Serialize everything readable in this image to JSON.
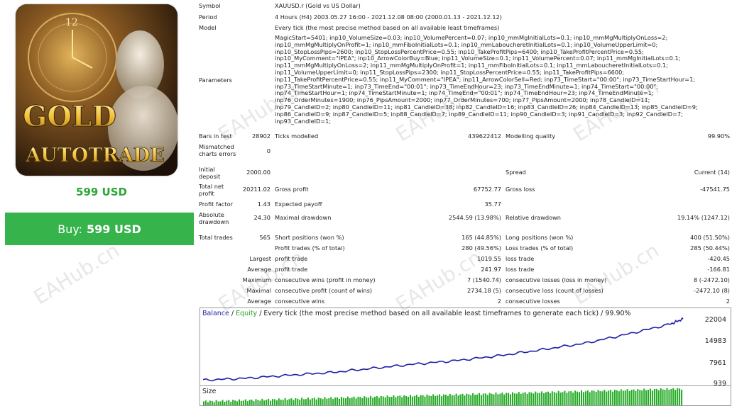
{
  "product": {
    "title_line1": "GOLD",
    "title_line2": "AUTOTRADE",
    "price": "599 USD",
    "buy_label": "Buy:",
    "buy_price": "599 USD"
  },
  "report": {
    "symbol_label": "Symbol",
    "symbol_value": "XAUUSD.r (Gold vs US Dollar)",
    "period_label": "Period",
    "period_value": "4 Hours (H4) 2003.05.27 16:00 - 2021.12.08 08:00 (2000.01.13 - 2021.12.12)",
    "model_label": "Model",
    "model_value": "Every tick (the most precise method based on all available least timeframes)",
    "parameters_label": "Parameters",
    "parameters_lines": [
      "MagicStart=5401; inp10_VolumeSize=0.03; inp10_VolumePercent=0.07; inp10_mmMgInitialLots=0.1; inp10_mmMgMultiplyOnLoss=2;",
      "inp10_mmMgMultiplyOnProfit=1; inp10_mmFiboInitialLots=0.1; inp10_mmLaboucheretInitialLots=0.1; inp10_VolumeUpperLimit=0;",
      "inp10_StopLossPips=2600; inp10_StopLossPercentPrice=0.55; inp10_TakeProfitPips=6400; inp10_TakeProfitPercentPrice=0.55;",
      "inp10_MyComment=\"IPEA\"; inp10_ArrowColorBuy=Blue; inp11_VolumeSize=0.1; inp11_VolumePercent=0.07; inp11_mmMgInitialLots=0.1;",
      "inp11_mmMgMultiplyOnLoss=2; inp11_mmMgMultiplyOnProfit=1; inp11_mmFiboInitialLots=0.1; inp11_mmLaboucheretInitialLots=0.1;",
      "inp11_VolumeUpperLimit=0; inp11_StopLossPips=2300; inp11_StopLossPercentPrice=0.55; inp11_TakeProfitPips=6600;",
      "inp11_TakeProfitPercentPrice=0.55; inp11_MyComment=\"IPEA\"; inp11_ArrowColorSell=Red; inp73_TimeStart=\"00:00\"; inp73_TimeStartHour=1;",
      "inp73_TimeStartMinute=1; inp73_TimeEnd=\"00:01\"; inp73_TimeEndHour=23; inp73_TimeEndMinute=1; inp74_TimeStart=\"00:00\";",
      "inp74_TimeStartHour=1; inp74_TimeStartMinute=1; inp74_TimeEnd=\"00:01\"; inp74_TimeEndHour=23; inp74_TimeEndMinute=1;",
      "inp76_OrderMinutes=1900; inp76_PipsAmount=2000; inp77_OrderMinutes=700; inp77_PipsAmount=2000; inp78_CandleID=11;",
      "inp79_CandleID=2; inp80_CandleID=11; inp81_CandleID=38; inp82_CandleID=16; inp83_CandleID=26; inp84_CandleID=13; inp85_CandleID=9;",
      "inp86_CandleID=9; inp87_CandleID=5; inp88_CandleID=7; inp89_CandleID=11; inp90_CandleID=3; inp91_CandleID=3; inp92_CandleID=7;",
      "inp93_CandleID=1;"
    ],
    "bars_label": "Bars in test",
    "bars_value": "28902",
    "ticks_label": "Ticks modelled",
    "ticks_value": "439622412",
    "quality_label": "Modelling quality",
    "quality_value": "99.90%",
    "mismatched_label": "Mismatched charts errors",
    "mismatched_value": "0",
    "initial_label": "Initial deposit",
    "initial_value": "2000.00",
    "spread_label": "Spread",
    "spread_value": "Current (14)",
    "netprofit_label": "Total net profit",
    "netprofit_value": "20211.02",
    "grossprofit_label": "Gross profit",
    "grossprofit_value": "67752.77",
    "grossloss_label": "Gross loss",
    "grossloss_value": "-47541.75",
    "pf_label": "Profit factor",
    "pf_value": "1.43",
    "expected_label": "Expected payoff",
    "expected_value": "35.77",
    "absdd_label": "Absolute drawdown",
    "absdd_value": "24.30",
    "maxdd_label": "Maximal drawdown",
    "maxdd_value": "2544.59 (13.98%)",
    "reldd_label": "Relative drawdown",
    "reldd_value": "19.14% (1247.12)",
    "trades_label": "Total trades",
    "trades_value": "565",
    "short_label": "Short positions (won %)",
    "short_value": "165 (44.85%)",
    "long_label": "Long positions (won %)",
    "long_value": "400 (51.50%)",
    "profittrades_label": "Profit trades (% of total)",
    "profittrades_value": "280 (49.56%)",
    "losstrades_label": "Loss trades (% of total)",
    "losstrades_value": "285 (50.44%)",
    "largest_label": "Largest",
    "largest_profit_label": "profit trade",
    "largest_profit_value": "1019.55",
    "largest_loss_label": "loss trade",
    "largest_loss_value": "-420.45",
    "average_label": "Average",
    "average_profit_label": "profit trade",
    "average_profit_value": "241.97",
    "average_loss_label": "loss trade",
    "average_loss_value": "-166.81",
    "maximum_label": "Maximum",
    "max_cw_label": "consecutive wins (profit in money)",
    "max_cw_value": "7 (1540.74)",
    "max_cl_label": "consecutive losses (loss in money)",
    "max_cl_value": "8 (-2472.10)",
    "maximal_label": "Maximal",
    "max_cp_label": "consecutive profit (count of wins)",
    "max_cp_value": "2734.18 (5)",
    "max_closs_label": "consecutive loss (count of losses)",
    "max_closs_value": "-2472.10 (8)",
    "avg2_label": "Average",
    "avg_cw_label": "consecutive wins",
    "avg_cw_value": "2",
    "avg_cl_label": "consecutive losses",
    "avg_cl_value": "2"
  },
  "chart": {
    "title_balance": "Balance",
    "title_sep1": " / ",
    "title_equity": "Equity",
    "title_rest": " / Every tick (the most precise method based on all available least timeframes to generate each tick) / 99.90%",
    "y_labels": [
      "22004",
      "14983",
      "7961",
      "939"
    ],
    "size_label": "Size",
    "balance_color": "#1f1fa8",
    "size_color": "#22aa22"
  },
  "chart_data": {
    "type": "line",
    "x": [
      0,
      50,
      100,
      150,
      200,
      250,
      300,
      350,
      400,
      450,
      500,
      550,
      565
    ],
    "series": [
      {
        "name": "Balance",
        "values": [
          2000,
          2600,
          3600,
          4500,
          5900,
          7300,
          8500,
          10100,
          12100,
          14200,
          17200,
          20500,
          22211
        ]
      }
    ],
    "ylim": [
      939,
      22004
    ],
    "yticks": [
      22004,
      14983,
      7961,
      939
    ]
  },
  "watermark": "EAHub.cn"
}
